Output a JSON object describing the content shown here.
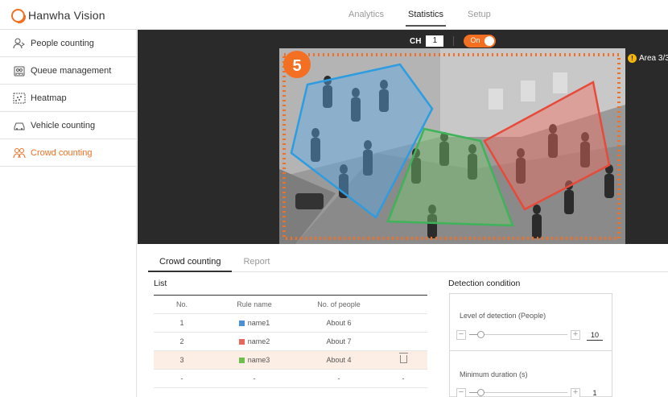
{
  "header": {
    "logo_text": "Hanwha Vision",
    "nav": [
      {
        "label": "Analytics",
        "active": false
      },
      {
        "label": "Statistics",
        "active": true
      },
      {
        "label": "Setup",
        "active": false
      }
    ]
  },
  "sidebar": {
    "items": [
      {
        "label": "People counting",
        "icon": "people-counting-icon",
        "active": false
      },
      {
        "label": "Queue management",
        "icon": "queue-icon",
        "active": false
      },
      {
        "label": "Heatmap",
        "icon": "heatmap-icon",
        "active": false
      },
      {
        "label": "Vehicle counting",
        "icon": "vehicle-icon",
        "active": false
      },
      {
        "label": "Crowd counting",
        "icon": "crowd-icon",
        "active": true
      }
    ]
  },
  "video": {
    "ch_label": "CH",
    "ch_value": "1",
    "toggle_label": "On",
    "toggle_on": true,
    "area_badge": "Area 3/3",
    "marker_number": "5"
  },
  "tabs": [
    {
      "label": "Crowd counting",
      "active": true
    },
    {
      "label": "Report",
      "active": false
    }
  ],
  "list": {
    "title": "List",
    "columns": [
      "No.",
      "Rule name",
      "No. of people"
    ],
    "rows": [
      {
        "no": "1",
        "name": "name1",
        "color": "#4a90d9",
        "people": "About 6",
        "selected": false
      },
      {
        "no": "2",
        "name": "name2",
        "color": "#e8675a",
        "people": "About 7",
        "selected": false
      },
      {
        "no": "3",
        "name": "name3",
        "color": "#6cc04a",
        "people": "About 4",
        "selected": true
      },
      {
        "no": "-",
        "name": "-",
        "people": "-",
        "extra": "-"
      }
    ]
  },
  "detection": {
    "title": "Detection condition",
    "level_label": "Level of detection (People)",
    "level_value": "10",
    "duration_label": "Minimum duration (s)",
    "duration_value": "1"
  },
  "colors": {
    "accent": "#f36f21",
    "area_blue": "#4a90d9",
    "area_red": "#e8675a",
    "area_green": "#6cc04a"
  }
}
